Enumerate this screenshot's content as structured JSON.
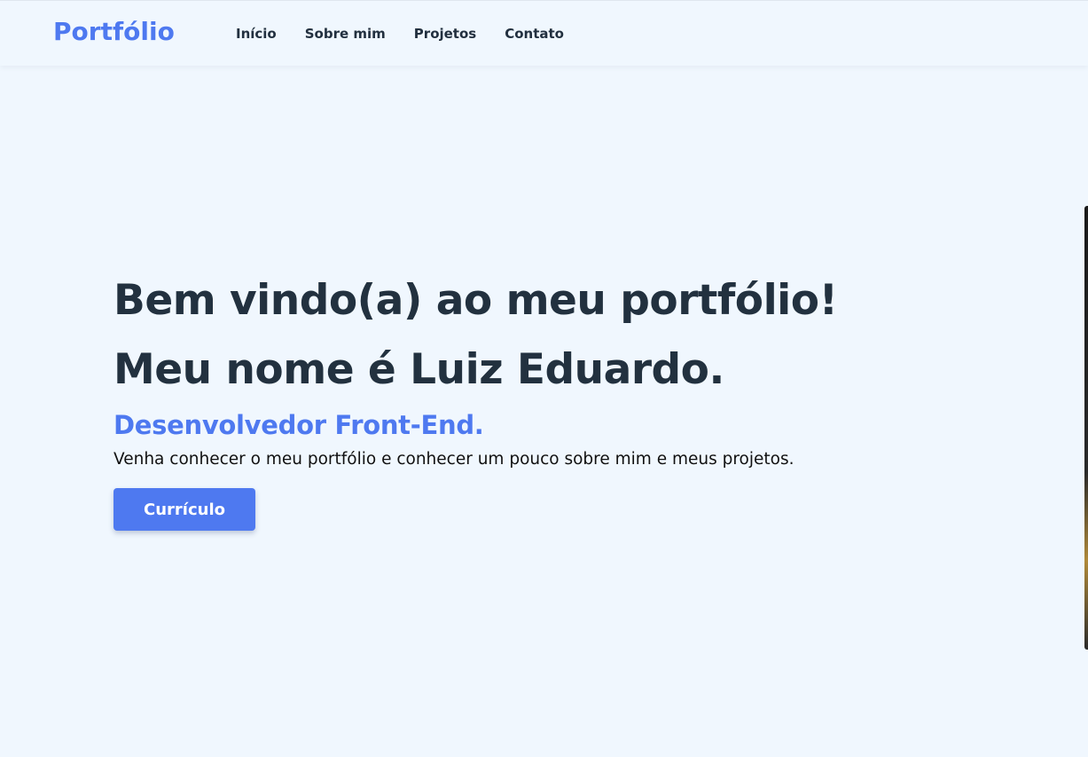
{
  "nav": {
    "logo": "Portfólio",
    "links": [
      "Início",
      "Sobre mim",
      "Projetos",
      "Contato"
    ]
  },
  "hero": {
    "line1": "Bem vindo(a) ao meu portfólio!",
    "line2": "Meu nome é Luiz Eduardo.",
    "role": "Desenvolvedor Front-End.",
    "description": "Venha conhecer o meu portfólio e conhecer um pouco sobre mim e meus projetos.",
    "button_label": "Currículo"
  },
  "colors": {
    "accent": "#4e79f0",
    "text_dark": "#22313f",
    "background": "#f0f7fe"
  }
}
